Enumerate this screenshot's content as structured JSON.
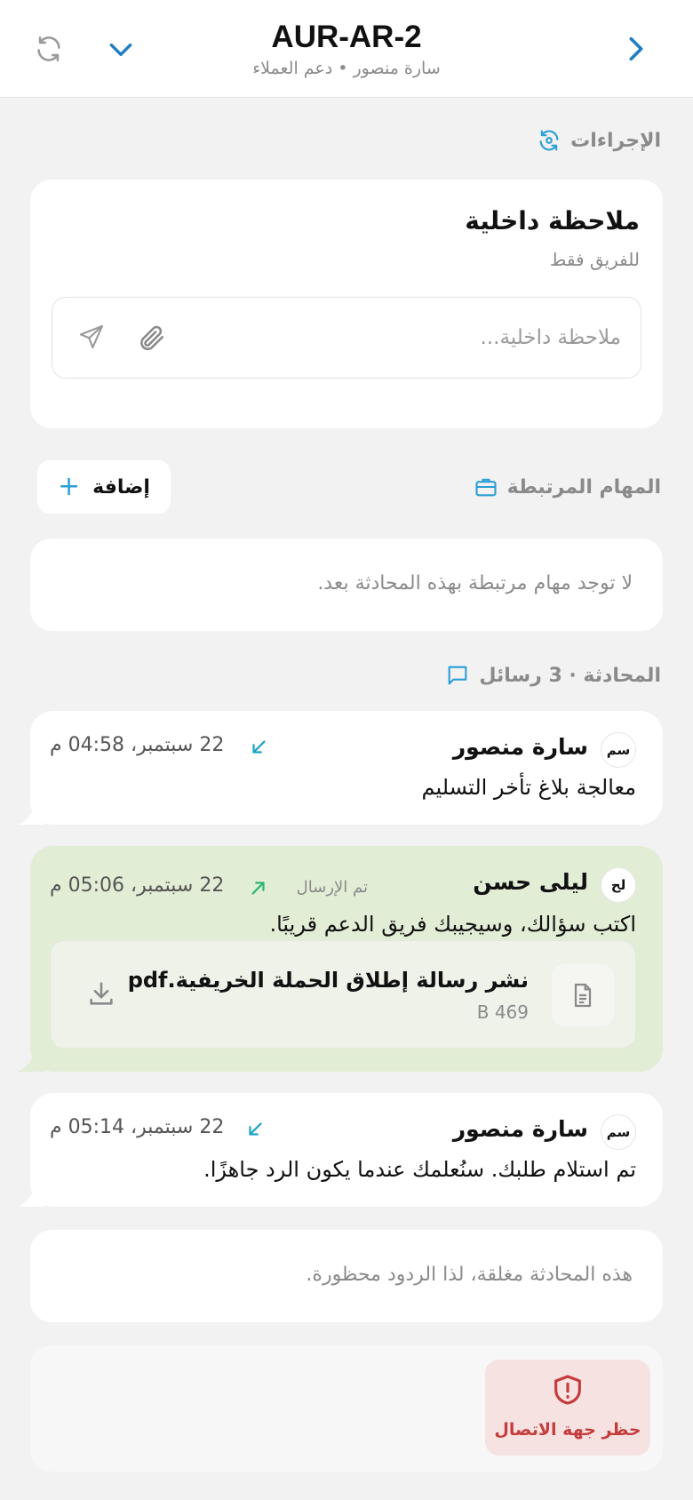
{
  "header": {
    "title": "AUR-AR-2",
    "subtitle": "سارة منصور • دعم العملاء",
    "refresh_icon": "refresh-icon",
    "collapse_icon": "chevron-down-icon",
    "next_icon": "chevron-right-icon"
  },
  "actions_section": {
    "label": "الإجراءات",
    "icon": "sync-icon"
  },
  "internal_note": {
    "title": "ملاحظة داخلية",
    "subtitle": "للفريق فقط",
    "placeholder": "ملاحظة داخلية...",
    "attach_icon": "paperclip-icon",
    "send_icon": "send-icon"
  },
  "tasks_section": {
    "label": "المهام المرتبطة",
    "icon": "briefcase-icon",
    "add_label": "إضافة",
    "empty_text": "لا توجد مهام مرتبطة بهذه المحادثة بعد."
  },
  "conversation_section": {
    "label": "المحادثة · 3 رسائل",
    "icon": "chat-icon"
  },
  "messages": [
    {
      "avatar": "سم",
      "sender": "سارة منصور",
      "direction": "incoming",
      "time": "22 سبتمبر، 04:58 م",
      "text": "معالجة بلاغ تأخر التسليم"
    },
    {
      "avatar": "لح",
      "sender": "ليلى حسن",
      "direction": "outgoing",
      "status": "تم الإرسال",
      "time": "22 سبتمبر، 05:06 م",
      "text": "اكتب سؤالك، وسيجيبك فريق الدعم قريبًا.",
      "attachment": {
        "name": "نشر رسالة إطلاق الحملة الخريفية.pdf",
        "size": "469 B"
      }
    },
    {
      "avatar": "سم",
      "sender": "سارة منصور",
      "direction": "incoming",
      "time": "22 سبتمبر، 05:14 م",
      "text": "تم استلام طلبك. سنُعلمك عندما يكون الرد جاهزًا."
    }
  ],
  "closed_notice": "هذه المحادثة مغلقة، لذا الردود محظورة.",
  "block_contact": {
    "label": "حظر جهة الاتصال",
    "icon": "shield-alert-icon"
  },
  "colors": {
    "accent": "#2a9fd6",
    "incoming_arrow": "#1aa3c8",
    "outgoing_arrow": "#2bb673",
    "outgoing_bubble": "#e2edd6",
    "danger": "#c43c3c",
    "danger_bg": "#f7e2e2"
  }
}
